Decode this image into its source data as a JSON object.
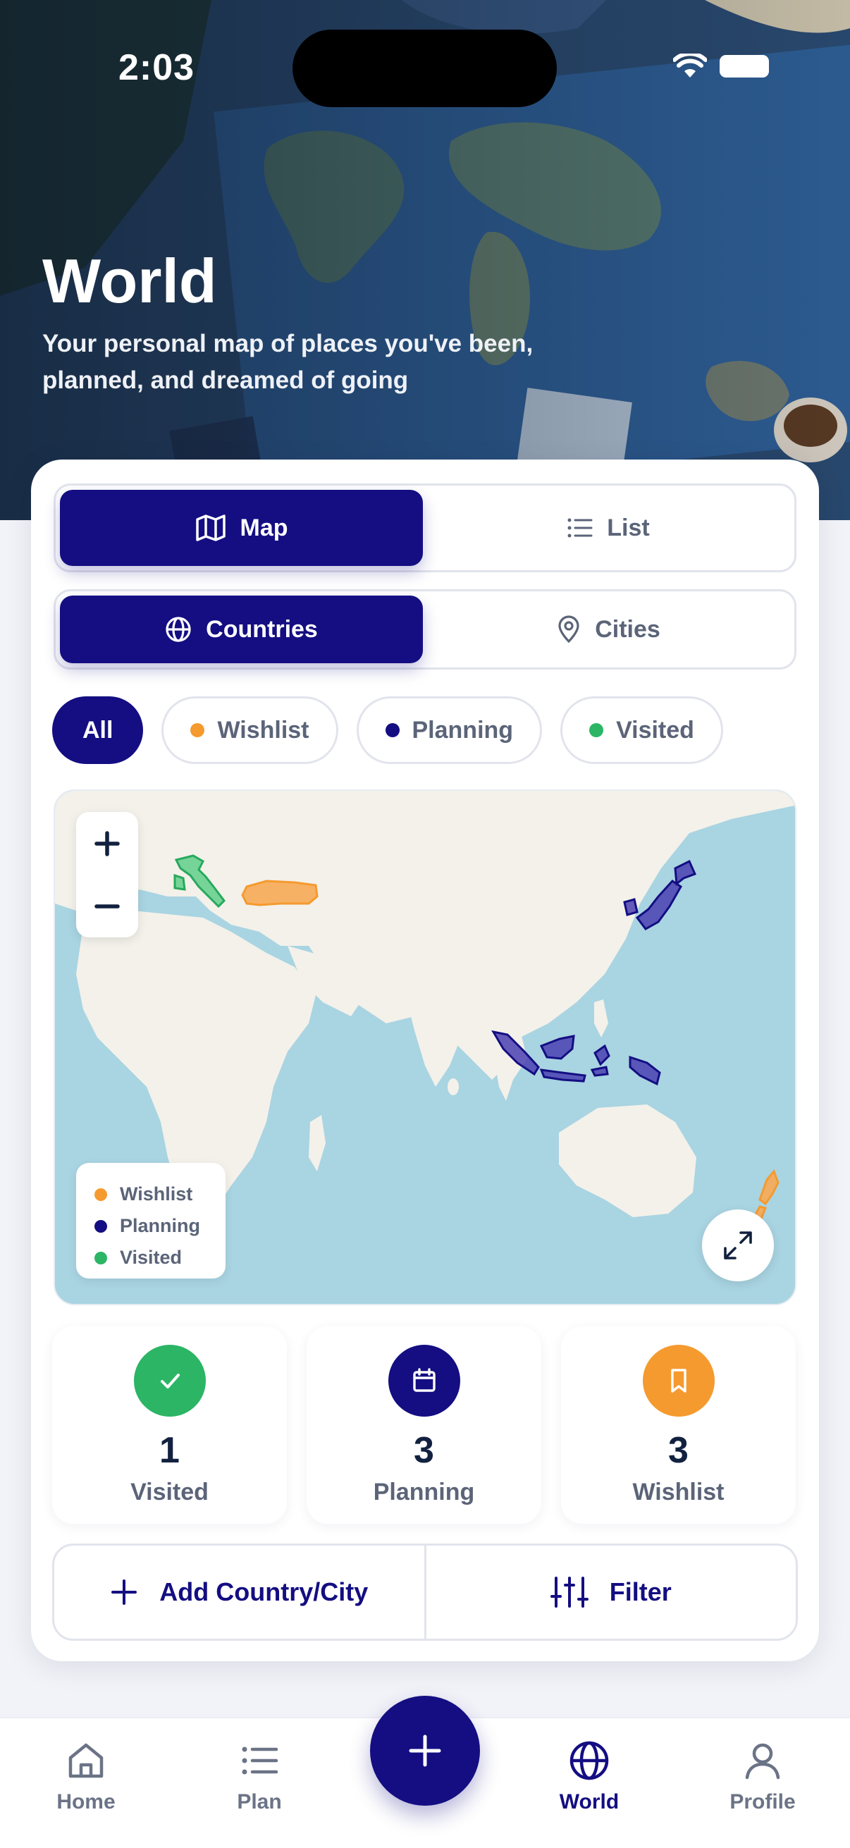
{
  "status_bar": {
    "time": "2:03"
  },
  "hero": {
    "title": "World",
    "subtitle": "Your personal map of places you've been, planned, and dreamed of going"
  },
  "view_toggle": {
    "map_label": "Map",
    "list_label": "List",
    "active": "Map"
  },
  "scope_toggle": {
    "countries_label": "Countries",
    "cities_label": "Cities",
    "active": "Countries"
  },
  "filters": {
    "active": "All",
    "chips": [
      {
        "label": "All"
      },
      {
        "label": "Wishlist",
        "color": "#f59a2f"
      },
      {
        "label": "Planning",
        "color": "#140e82"
      },
      {
        "label": "Visited",
        "color": "#2bb565"
      }
    ]
  },
  "map": {
    "zoom_in": "+",
    "zoom_out": "−",
    "legend": [
      {
        "label": "Wishlist",
        "color": "#f59a2f"
      },
      {
        "label": "Planning",
        "color": "#140e82"
      },
      {
        "label": "Visited",
        "color": "#2bb565"
      }
    ],
    "colors": {
      "ocean": "#a9d4e2",
      "land": "#f3f1ea"
    },
    "highlighted": {
      "visited": [
        "Italy"
      ],
      "planning": [
        "Japan",
        "Indonesia",
        "Papua"
      ],
      "wishlist": [
        "Turkey",
        "New Zealand"
      ]
    }
  },
  "stats": [
    {
      "label": "Visited",
      "value": "1",
      "color": "#2bb565",
      "icon": "check-icon"
    },
    {
      "label": "Planning",
      "value": "3",
      "color": "#140e82",
      "icon": "calendar-icon"
    },
    {
      "label": "Wishlist",
      "value": "3",
      "color": "#f59a2f",
      "icon": "bookmark-icon"
    }
  ],
  "actions": {
    "add_label": "Add Country/City",
    "filter_label": "Filter"
  },
  "nav": {
    "active": "World",
    "items": [
      {
        "label": "Home",
        "icon": "home-icon"
      },
      {
        "label": "Plan",
        "icon": "list-icon"
      },
      {
        "label": "World",
        "icon": "globe-icon"
      },
      {
        "label": "Profile",
        "icon": "profile-icon"
      }
    ],
    "fab_icon": "plus-icon"
  }
}
